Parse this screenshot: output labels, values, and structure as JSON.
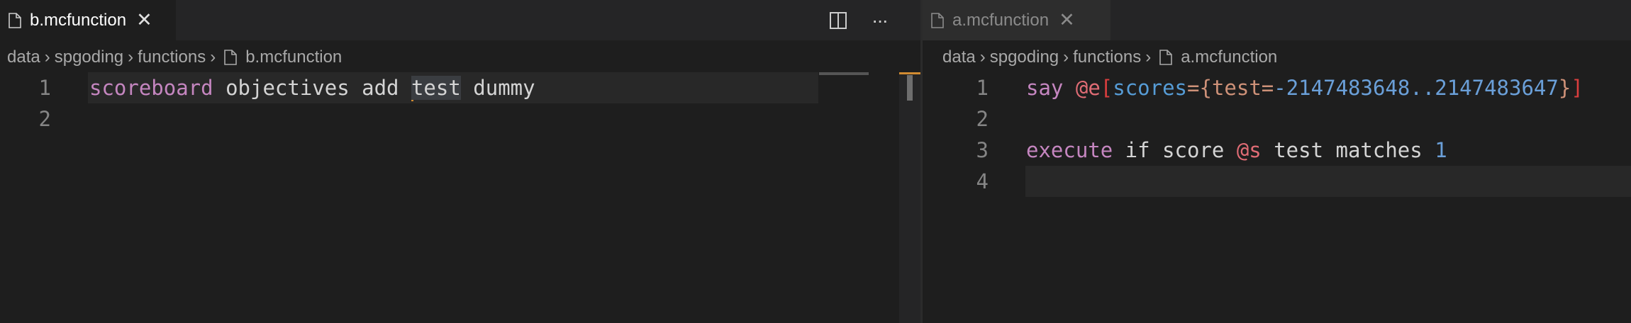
{
  "left": {
    "tab": {
      "label": "b.mcfunction",
      "close": "✕"
    },
    "actions": {
      "split_icon": "split-editor-icon",
      "more_label": "···"
    },
    "breadcrumbs": [
      "data",
      "spgoding",
      "functions",
      "b.mcfunction"
    ],
    "lines": [
      {
        "number": "1",
        "tokens": [
          "scoreboard",
          " objectives add ",
          "test",
          " dummy"
        ]
      },
      {
        "number": "2"
      }
    ]
  },
  "right": {
    "tab": {
      "label": "a.mcfunction",
      "close": "✕"
    },
    "breadcrumbs": [
      "data",
      "spgoding",
      "functions",
      "a.mcfunction"
    ],
    "lines": [
      {
        "number": "1",
        "tokens": [
          "say",
          " ",
          "@e",
          "[",
          "scores",
          "=",
          "{",
          "test",
          "=",
          "-2147483648..2147483647",
          "}",
          "]"
        ]
      },
      {
        "number": "2"
      },
      {
        "number": "3",
        "tokens": [
          "execute",
          " if score ",
          "@s",
          " test matches ",
          "1"
        ]
      },
      {
        "number": "4"
      }
    ]
  },
  "colors": {
    "background": "#1e1e1e",
    "keyword": "#c586c0",
    "selector": "#e06c75",
    "key": "#569cd6",
    "tag": "#ce9178",
    "number": "#6a9fd8",
    "cursor": "#d18b32"
  }
}
